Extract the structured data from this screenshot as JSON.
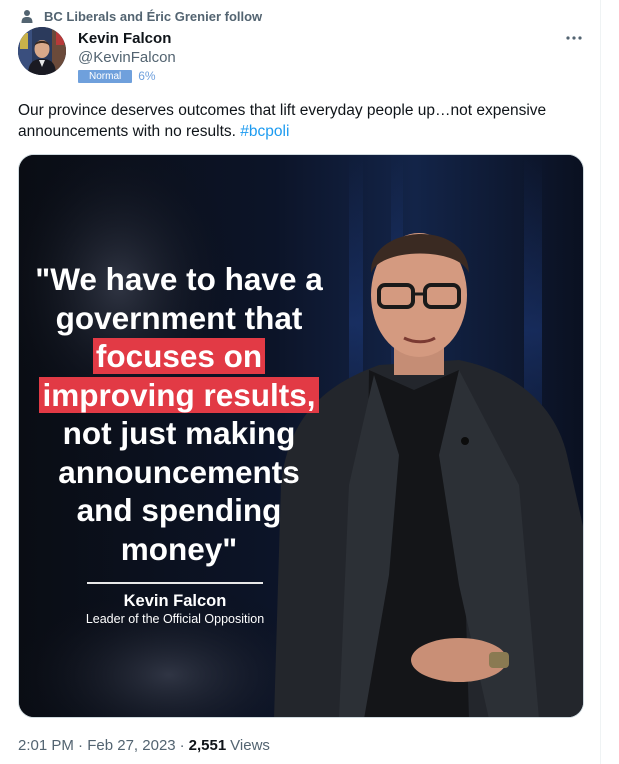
{
  "social_context": {
    "text": "BC Liberals and Éric Grenier follow",
    "icon": "person-icon"
  },
  "author": {
    "name": "Kevin Falcon",
    "handle": "@KevinFalcon",
    "badge_label": "Normal",
    "badge_percent": "6%",
    "avatar": "avatar-photo"
  },
  "more_icon": "more-horizontal-icon",
  "tweet": {
    "text": "Our province deserves outcomes that lift everyday people up…not expensive announcements with no results. ",
    "hashtag": "#bcpoli"
  },
  "media": {
    "quote_lines": [
      {
        "text": "\"We have to have a",
        "highlight": false
      },
      {
        "text": "government that",
        "highlight": false
      },
      {
        "text": "focuses on",
        "highlight": true
      },
      {
        "text": "improving results,",
        "highlight": true
      },
      {
        "text": "not just making",
        "highlight": false
      },
      {
        "text": "announcements",
        "highlight": false
      },
      {
        "text": "and spending",
        "highlight": false
      },
      {
        "text": "money\"",
        "highlight": false
      }
    ],
    "signature_name": "Kevin Falcon",
    "signature_title": "Leader of the Official Opposition",
    "highlight_color": "#e23a45"
  },
  "footer": {
    "time": "2:01 PM",
    "separator": "·",
    "date": "Feb 27, 2023",
    "views_count": "2,551",
    "views_label": "Views"
  },
  "colors": {
    "accent": "#1d9bf0",
    "muted": "#536471",
    "badge": "#6fa0dc"
  }
}
